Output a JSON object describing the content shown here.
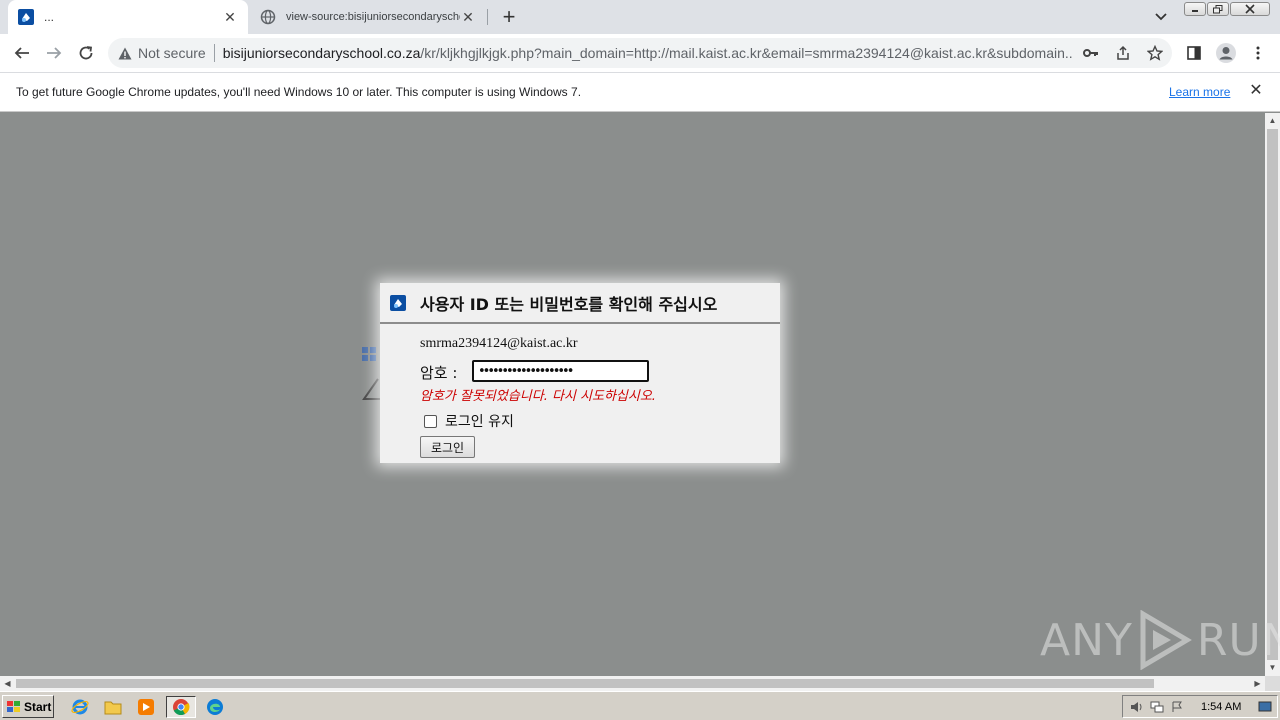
{
  "browser": {
    "tabs": [
      {
        "title": "...",
        "active": true
      },
      {
        "title": "view-source:bisijuniorsecondaryschool.co.za",
        "active": false
      }
    ],
    "new_tab_label": "+",
    "address": {
      "security_label": "Not secure",
      "host": "bisijuniorsecondaryschool.co.za",
      "path": "/kr/kljkhgjlkjgk.php?main_domain=http://mail.kaist.ac.kr&email=smrma2394124@kaist.ac.kr&subdomain..."
    }
  },
  "infobar": {
    "message": "To get future Google Chrome updates, you'll need Windows 10 or later. This computer is using Windows 7.",
    "link": "Learn more"
  },
  "dialog": {
    "title": "사용자 ID 또는 비밀번호를 확인해 주십시오",
    "email": "smrma2394124@kaist.ac.kr",
    "password_label": "암호 :",
    "password_value": "••••••••••••••••••••",
    "error": "암호가 잘못되었습니다. 다시 시도하십시오.",
    "keep_signed_in": "로그인 유지",
    "keep_checked": false,
    "login_button": "로그인"
  },
  "watermark": {
    "left": "ANY",
    "right": "RUN"
  },
  "taskbar": {
    "start_label": "Start",
    "apps": [
      "internet-explorer-icon",
      "folder-icon",
      "media-player-icon",
      "chrome-icon",
      "edge-icon"
    ],
    "clock": "1:54 AM"
  },
  "colors": {
    "page_bg": "#8b8e8d",
    "error": "#cc0000",
    "link": "#1a73e8"
  }
}
